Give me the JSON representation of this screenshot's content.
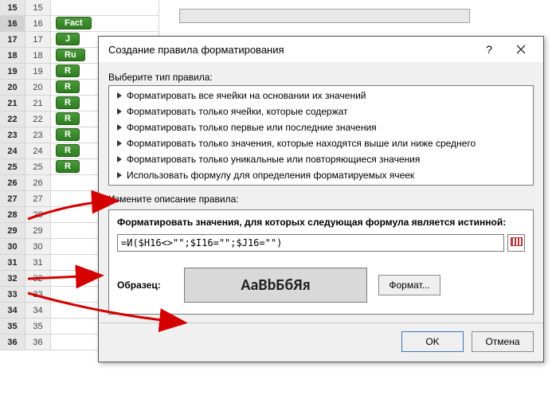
{
  "sheet": {
    "rows": [
      15,
      16,
      17,
      18,
      19,
      20,
      21,
      22,
      23,
      24,
      25,
      26,
      27,
      28,
      29,
      30,
      31,
      32,
      33,
      34,
      35,
      36
    ],
    "selected_row": 16,
    "pills": {
      "16": "Fact",
      "17": "J",
      "18": "Ru",
      "19": "R",
      "20": "R",
      "21": "R",
      "22": "R",
      "23": "R",
      "24": "R",
      "25": "R"
    }
  },
  "formula_bar": {
    "value": ""
  },
  "dialog": {
    "title": "Создание правила форматирования",
    "section1_label": "Выберите тип правила:",
    "rules": [
      "Форматировать все ячейки на основании их значений",
      "Форматировать только ячейки, которые содержат",
      "Форматировать только первые или последние значения",
      "Форматировать только значения, которые находятся выше или ниже среднего",
      "Форматировать только уникальные или повторяющиеся значения",
      "Использовать формулу для определения форматируемых ячеек"
    ],
    "section2_label": "Измените описание правила:",
    "formula_label": "Форматировать значения, для которых следующая формула является истинной:",
    "formula_value": "=И($H16<>\"\";$I16=\"\";$J16=\"\")",
    "preview_label": "Образец:",
    "preview_text": "АаВbБбЯя",
    "format_btn": "Формат...",
    "ok": "OK",
    "cancel": "Отмена"
  }
}
